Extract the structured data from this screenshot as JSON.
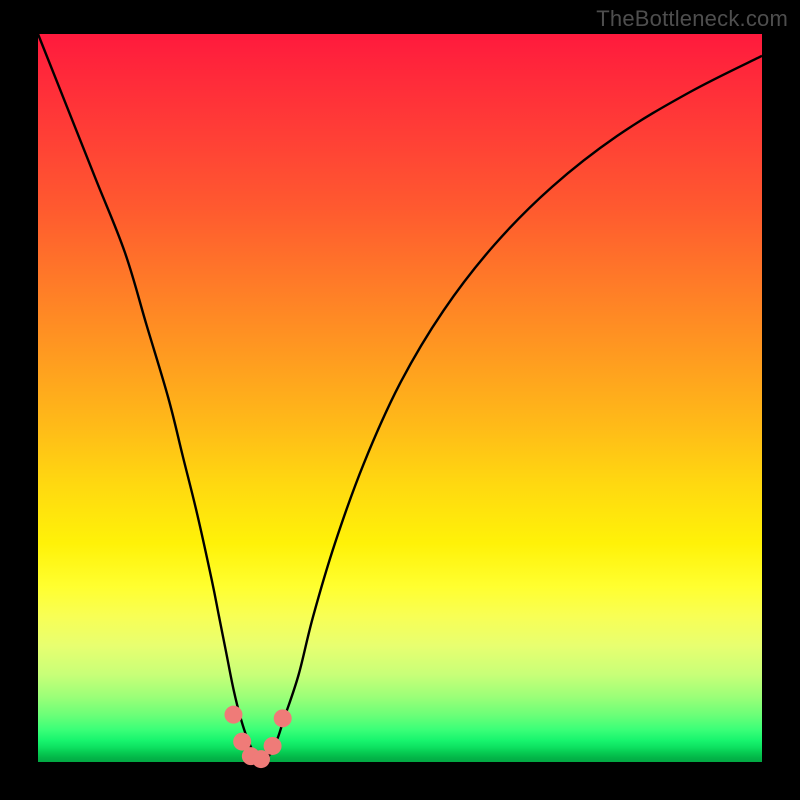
{
  "watermark": "TheBottleneck.com",
  "chart_data": {
    "type": "line",
    "title": "",
    "xlabel": "",
    "ylabel": "",
    "xlim": [
      0,
      100
    ],
    "ylim": [
      0,
      100
    ],
    "grid": false,
    "legend": false,
    "annotations": [],
    "series": [
      {
        "name": "bottleneck-curve",
        "x": [
          0,
          4,
          8,
          12,
          15,
          18,
          20,
          22,
          24,
          25,
          26,
          27,
          28,
          29,
          30,
          31,
          32,
          33,
          34,
          36,
          38,
          41,
          45,
          50,
          56,
          63,
          71,
          80,
          90,
          100
        ],
        "values": [
          100,
          90,
          80,
          70,
          60,
          50,
          42,
          34,
          25,
          20,
          15,
          10,
          6,
          3,
          1,
          0,
          1,
          3,
          6,
          12,
          20,
          30,
          41,
          52,
          62,
          71,
          79,
          86,
          92,
          97
        ]
      }
    ],
    "markers": [
      {
        "x": 27.0,
        "y": 6.5
      },
      {
        "x": 28.2,
        "y": 2.8
      },
      {
        "x": 29.4,
        "y": 0.8
      },
      {
        "x": 30.8,
        "y": 0.4
      },
      {
        "x": 32.4,
        "y": 2.2
      },
      {
        "x": 33.8,
        "y": 6.0
      }
    ],
    "marker_color": "#ef7b78",
    "curve_color": "#000000",
    "gradient_stops": [
      {
        "pos": 0.0,
        "color": "#ff1a3d"
      },
      {
        "pos": 0.5,
        "color": "#ffb818"
      },
      {
        "pos": 0.76,
        "color": "#ffff30"
      },
      {
        "pos": 1.0,
        "color": "#02a843"
      }
    ]
  }
}
